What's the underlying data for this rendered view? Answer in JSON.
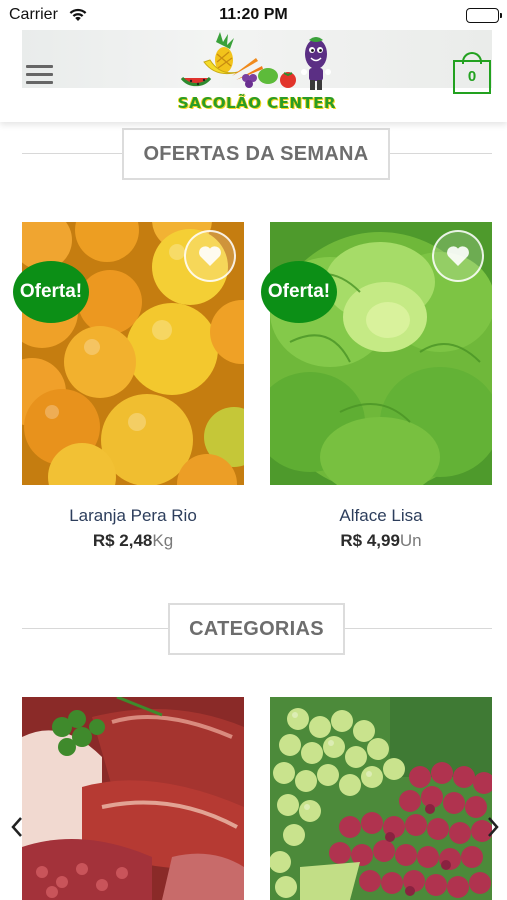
{
  "status_bar": {
    "carrier": "Carrier",
    "time": "11:20 PM"
  },
  "header": {
    "logo_text": "SACOLÃO CENTER",
    "cart_count": "0",
    "accent_color": "#22a11f"
  },
  "offers": {
    "section_title": "OFERTAS DA SEMANA",
    "products": [
      {
        "badge": "Oferta!",
        "name": "Laranja Pera Rio",
        "price": "R$ 2,48",
        "unit": "Kg",
        "image_icon": "oranges-photo"
      },
      {
        "badge": "Oferta!",
        "name": "Alface Lisa",
        "price": "R$ 4,99",
        "unit": "Un",
        "image_icon": "lettuce-photo"
      }
    ]
  },
  "categories": {
    "section_title": "CATEGORIAS",
    "items": [
      {
        "image_icon": "meat-photo"
      },
      {
        "image_icon": "grapes-photo"
      }
    ]
  },
  "colors": {
    "badge_green": "#0c8f16",
    "title_gray": "#6d6d6d",
    "product_name": "#2d3e5c"
  }
}
